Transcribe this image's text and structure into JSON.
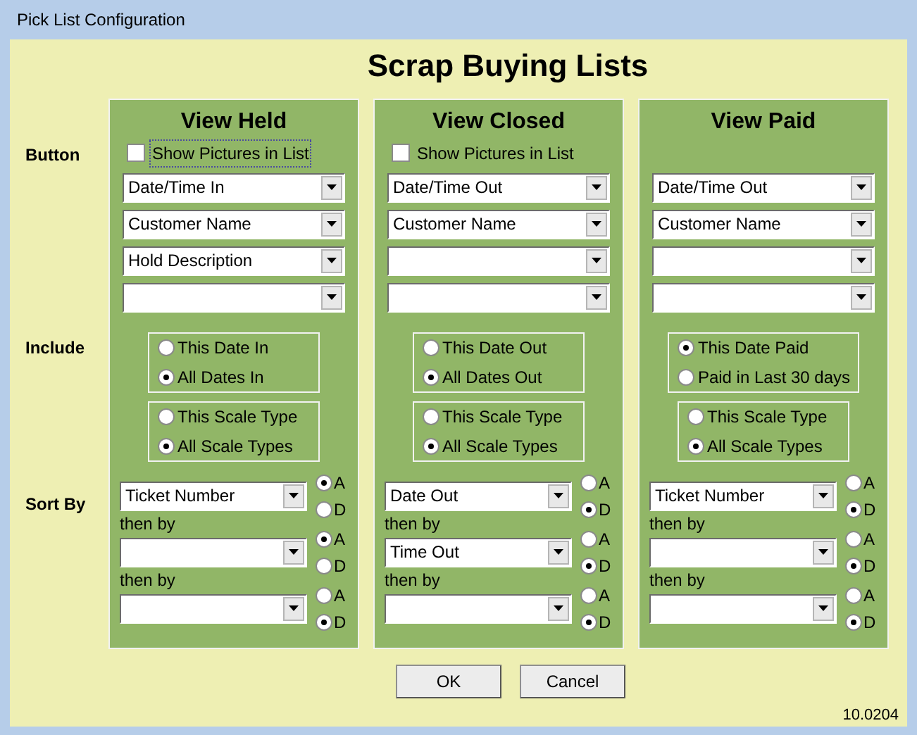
{
  "window": {
    "title": "Pick List Configuration"
  },
  "heading": "Scrap Buying Lists",
  "row_labels": [
    "Button",
    "Include",
    "Sort By"
  ],
  "panels": [
    {
      "title": "View Held",
      "show_pictures": {
        "label": "Show Pictures in List",
        "checked": false,
        "focused": true
      },
      "dropdowns": [
        "Date/Time In",
        "Customer Name",
        "Hold Description"
      ],
      "include_groups": [
        [
          {
            "label": "This Date In",
            "selected": false
          },
          {
            "label": "All Dates In",
            "selected": true
          }
        ],
        [
          {
            "label": "This Scale Type",
            "selected": false
          },
          {
            "label": "All Scale Types",
            "selected": true
          }
        ]
      ],
      "sort": [
        {
          "value": "Ticket Number",
          "order": [
            {
              "label": "A",
              "selected": true
            },
            {
              "label": "D",
              "selected": false
            }
          ]
        },
        {
          "then_label": "then by",
          "order": [
            {
              "label": "A",
              "selected": true
            },
            {
              "label": "D",
              "selected": false
            }
          ]
        },
        {
          "then_label": "then by",
          "order": [
            {
              "label": "A",
              "selected": false
            },
            {
              "label": "D",
              "selected": true
            }
          ]
        }
      ]
    },
    {
      "title": "View Closed",
      "show_pictures": {
        "label": "Show Pictures in List",
        "checked": false,
        "focused": false
      },
      "dropdowns": [
        "Date/Time Out",
        "Customer Name"
      ],
      "include_groups": [
        [
          {
            "label": "This Date Out",
            "selected": false
          },
          {
            "label": "All Dates Out",
            "selected": true
          }
        ],
        [
          {
            "label": "This Scale Type",
            "selected": false
          },
          {
            "label": "All Scale Types",
            "selected": true
          }
        ]
      ],
      "sort": [
        {
          "value": "Date Out",
          "order": [
            {
              "label": "A",
              "selected": false
            },
            {
              "label": "D",
              "selected": true
            }
          ]
        },
        {
          "then_label": "then by",
          "value": "Time Out",
          "order": [
            {
              "label": "A",
              "selected": false
            },
            {
              "label": "D",
              "selected": true
            }
          ]
        },
        {
          "then_label": "then by",
          "order": [
            {
              "label": "A",
              "selected": false
            },
            {
              "label": "D",
              "selected": true
            }
          ]
        }
      ]
    },
    {
      "title": "View Paid",
      "dropdowns": [
        "Date/Time Out",
        "Customer Name"
      ],
      "include_groups": [
        [
          {
            "label": "This Date Paid",
            "selected": true
          },
          {
            "label": "Paid in Last 30 days",
            "selected": false
          }
        ],
        [
          {
            "label": "This Scale Type",
            "selected": false
          },
          {
            "label": "All Scale Types",
            "selected": true
          }
        ]
      ],
      "sort": [
        {
          "value": "Ticket Number",
          "order": [
            {
              "label": "A",
              "selected": false
            },
            {
              "label": "D",
              "selected": true
            }
          ]
        },
        {
          "then_label": "then by",
          "order": [
            {
              "label": "A",
              "selected": false
            },
            {
              "label": "D",
              "selected": true
            }
          ]
        },
        {
          "then_label": "then by",
          "order": [
            {
              "label": "A",
              "selected": false
            },
            {
              "label": "D",
              "selected": true
            }
          ]
        }
      ]
    }
  ],
  "buttons": [
    "OK",
    "Cancel"
  ],
  "version": "10.0204"
}
